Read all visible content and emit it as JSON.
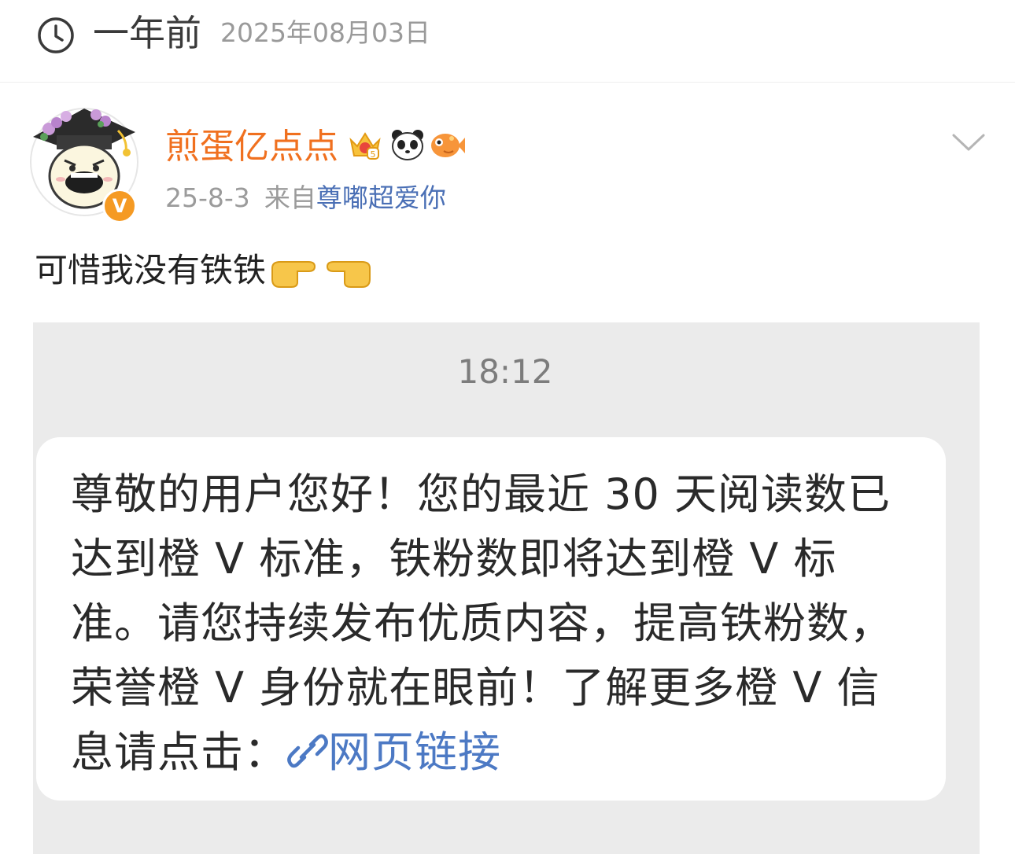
{
  "memory": {
    "icon": "clock-icon",
    "relative_time": "一年前",
    "date": "2025年08月03日"
  },
  "post": {
    "avatar": "avatar-icon",
    "verified_badge": "V",
    "username": "煎蛋亿点点",
    "badges": [
      "crown-badge-icon",
      "panda-badge-icon",
      "fish-badge-icon"
    ],
    "timestamp": "25-8-3",
    "source_prefix": "来自",
    "source_app": "尊嘟超爱你",
    "text": "可惜我没有铁铁",
    "text_emojis": [
      "pointing-right-emoji",
      "pointing-left-emoji"
    ],
    "menu_icon": "chevron-down-icon"
  },
  "image": {
    "sms_time": "18:12",
    "sms_text": "尊敬的用户您好！您的最近 30 天阅读数已达到橙 V 标准，铁粉数即将达到橙 V 标准。请您持续发布优质内容，提高铁粉数，荣誉橙 V 身份就在眼前！了解更多橙 V 信息请点击：",
    "link_icon": "link-icon",
    "link_text": "网页链接"
  },
  "colors": {
    "username": "#f0701f",
    "source_app": "#4a6fb5",
    "link": "#4c79c4",
    "verified": "#f59a23",
    "image_bg": "#ebebeb"
  }
}
